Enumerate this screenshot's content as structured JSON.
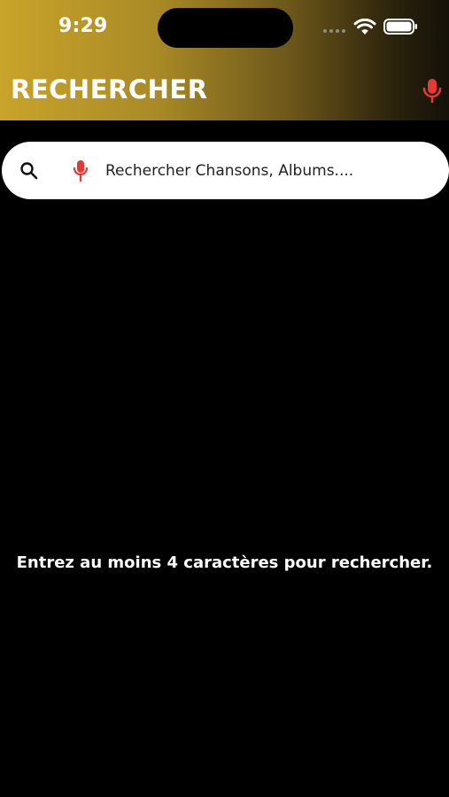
{
  "status_bar": {
    "time": "9:29"
  },
  "header": {
    "title": "RECHERCHER",
    "mic_icon": "microphone-icon",
    "accent_gold": "#c9a42a"
  },
  "search": {
    "placeholder": "Rechercher Chansons, Albums....",
    "value": "",
    "search_icon": "search-icon",
    "mic_icon": "microphone-icon",
    "mic_color": "#e53935"
  },
  "main": {
    "hint": "Entrez au moins 4 caractères pour rechercher."
  }
}
